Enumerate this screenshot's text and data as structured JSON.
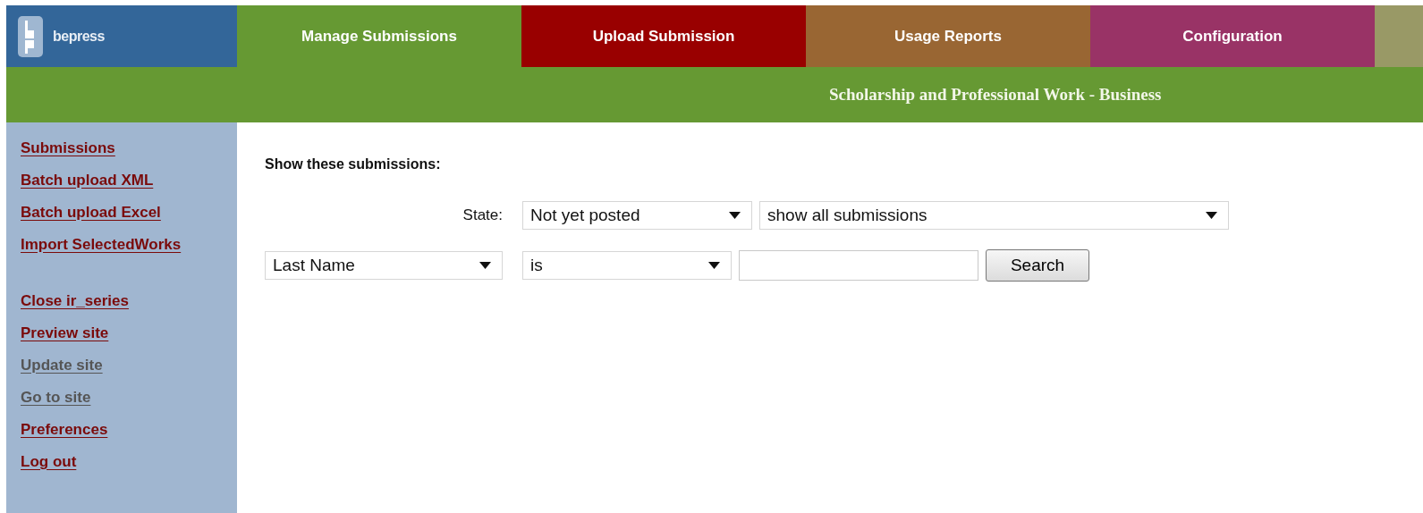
{
  "logo": {
    "text": "bepress"
  },
  "tabs": [
    {
      "label": "Manage Submissions",
      "selected": true,
      "color": "#669933"
    },
    {
      "label": "Upload Submission",
      "selected": false,
      "color": "#990000"
    },
    {
      "label": "Usage Reports",
      "selected": false,
      "color": "#996633"
    },
    {
      "label": "Configuration",
      "selected": false,
      "color": "#993366"
    }
  ],
  "banner": {
    "title": "Scholarship and Professional Work - Business"
  },
  "sidebar": {
    "groups": [
      [
        {
          "label": "Submissions",
          "disabled": false
        },
        {
          "label": "Batch upload XML",
          "disabled": false
        },
        {
          "label": "Batch upload Excel",
          "disabled": false
        },
        {
          "label": "Import SelectedWorks",
          "disabled": false
        }
      ],
      [
        {
          "label": "Close ir_series",
          "disabled": false
        },
        {
          "label": "Preview site",
          "disabled": false
        },
        {
          "label": "Update site",
          "disabled": true
        },
        {
          "label": "Go to site",
          "disabled": true
        },
        {
          "label": "Preferences",
          "disabled": false
        },
        {
          "label": "Log out",
          "disabled": false
        }
      ]
    ]
  },
  "filter": {
    "heading": "Show these submissions:",
    "state_label": "State:",
    "state": "Not yet posted",
    "scope": "show all submissions",
    "field": "Last Name",
    "operator": "is",
    "search_button": "Search"
  }
}
